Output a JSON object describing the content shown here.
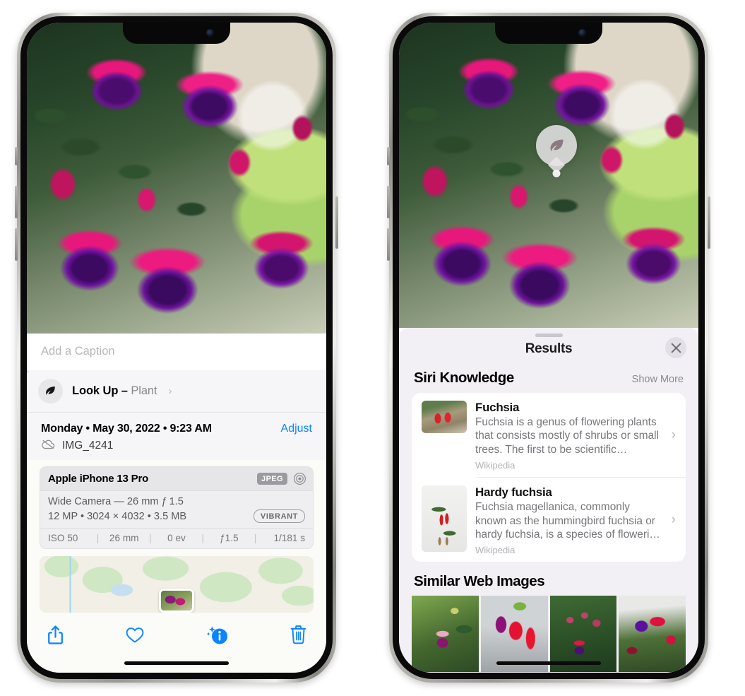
{
  "left_phone": {
    "name": "photos-detail-phone",
    "caption": {
      "placeholder": "Add a Caption",
      "value": ""
    },
    "lookup": {
      "label": "Look Up – ",
      "subject": "Plant",
      "chevron": "›",
      "icon": "leaf-icon"
    },
    "meta": {
      "date": "Monday • May 30, 2022 • 9:23 AM",
      "adjust_label": "Adjust",
      "filename": "IMG_4241",
      "cloud_icon": "icloud-slash-icon"
    },
    "camera": {
      "model": "Apple iPhone 13 Pro",
      "format_badge": "JPEG",
      "aperture_icon": "aperture-icon",
      "lens": "Wide Camera — 26 mm ƒ 1.5",
      "specs": "12 MP • 3024 × 4032 • 3.5 MB",
      "style_badge": "VIBRANT",
      "exif": [
        "ISO 50",
        "26 mm",
        "0 ev",
        "ƒ1.5",
        "1/181 s"
      ]
    },
    "toolbar": [
      {
        "name": "share-button",
        "icon": "share-icon"
      },
      {
        "name": "favorite-button",
        "icon": "heart-icon"
      },
      {
        "name": "info-button",
        "icon": "info-sparkle-icon"
      },
      {
        "name": "delete-button",
        "icon": "trash-icon"
      }
    ]
  },
  "right_phone": {
    "name": "visual-lookup-results-phone",
    "leaf_badge": {
      "icon": "leaf-icon"
    },
    "sheet": {
      "title": "Results",
      "close_icon": "close-icon",
      "grabber": "drag-handle"
    },
    "siri_knowledge": {
      "title": "Siri Knowledge",
      "show_more": "Show More",
      "items": [
        {
          "title": "Fuchsia",
          "description": "Fuchsia is a genus of flowering plants that consists mostly of shrubs or small trees. The first to be scientific…",
          "source": "Wikipedia",
          "chevron": "›"
        },
        {
          "title": "Hardy fuchsia",
          "description": "Fuchsia magellanica, commonly known as the hummingbird fuchsia or hardy fuchsia, is a species of floweri…",
          "source": "Wikipedia",
          "chevron": "›"
        }
      ]
    },
    "similar_web_images": {
      "title": "Similar Web Images",
      "tiles": [
        "web-image-1",
        "web-image-2",
        "web-image-3",
        "web-image-4"
      ]
    }
  },
  "colors": {
    "accent_blue": "#0a84ff",
    "sheet_bg": "#f2f0f5",
    "card_bg": "#ffffff",
    "secondary_text": "#8a8a8e"
  }
}
